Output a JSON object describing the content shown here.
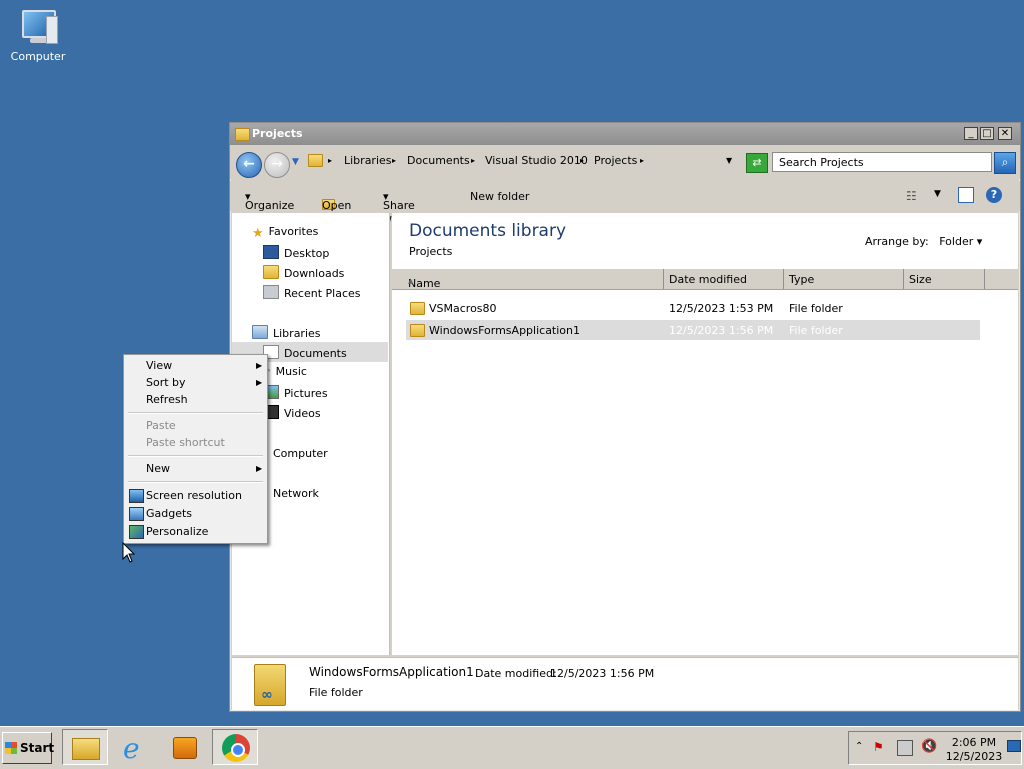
{
  "desktop": {
    "icon_label": "Computer"
  },
  "window": {
    "title": "Projects",
    "breadcrumb": [
      "Libraries",
      "Documents",
      "Visual Studio 2010",
      "Projects"
    ],
    "search_placeholder": "Search Projects",
    "toolbar": {
      "organize": "Organize",
      "open": "Open",
      "share_with": "Share with",
      "new_folder": "New folder"
    },
    "nav": {
      "favorites": "Favorites",
      "favorites_items": [
        "Desktop",
        "Downloads",
        "Recent Places"
      ],
      "libraries": "Libraries",
      "libraries_items": [
        "Documents",
        "Music",
        "Pictures",
        "Videos"
      ],
      "computer": "Computer",
      "network": "Network"
    },
    "library": {
      "heading": "Documents library",
      "subheading": "Projects",
      "arrange_label": "Arrange by:",
      "arrange_value": "Folder"
    },
    "columns": [
      "Name",
      "Date modified",
      "Type",
      "Size"
    ],
    "files": [
      {
        "name": "VSMacros80",
        "date": "12/5/2023 1:53 PM",
        "type": "File folder"
      },
      {
        "name": "WindowsFormsApplication1",
        "date": "12/5/2023 1:56 PM",
        "type": "File folder"
      }
    ],
    "details": {
      "name": "WindowsFormsApplication1",
      "date_label": "Date modified:",
      "date_value": "12/5/2023 1:56 PM",
      "type": "File folder"
    }
  },
  "context_menu": {
    "view": "View",
    "sort_by": "Sort by",
    "refresh": "Refresh",
    "paste": "Paste",
    "paste_shortcut": "Paste shortcut",
    "new": "New",
    "screen_resolution": "Screen resolution",
    "gadgets": "Gadgets",
    "personalize": "Personalize"
  },
  "taskbar": {
    "start": "Start",
    "time": "2:06 PM",
    "date": "12/5/2023"
  }
}
